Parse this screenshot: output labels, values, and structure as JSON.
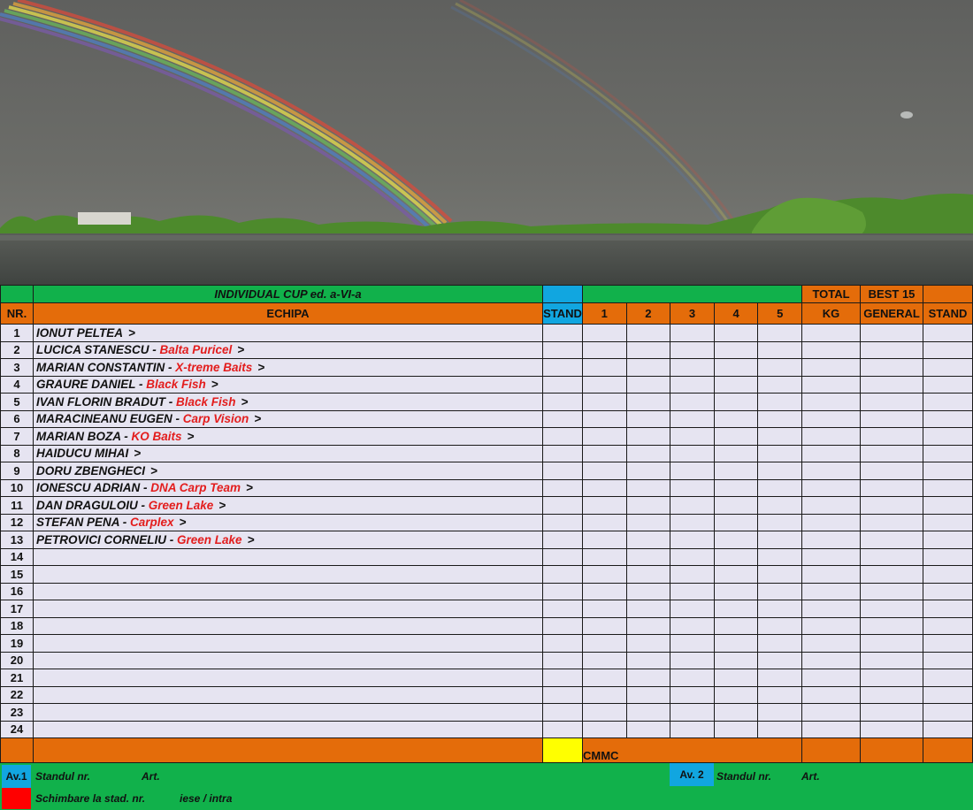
{
  "colors": {
    "green": "#11b14b",
    "orange": "#e46c0a",
    "blue": "#11a6e0",
    "team": "#e31d1d",
    "row_bg": "#e6e4f1",
    "yellow": "#ffff00"
  },
  "header": {
    "title": "INDIVIDUAL CUP ed. a-VI-a",
    "nr": "NR.",
    "echipa": "ECHIPA",
    "stand": "STAND",
    "sessions": [
      "1",
      "2",
      "3",
      "4",
      "5"
    ],
    "total": "TOTAL",
    "kg": "KG",
    "best": "BEST 15",
    "general": "GENERAL",
    "stand2": "STAND"
  },
  "rows": [
    {
      "nr": "1",
      "name": "IONUT PELTEA",
      "sep": "",
      "team": "",
      "tail": ">"
    },
    {
      "nr": "2",
      "name": "LUCICA STANESCU",
      "sep": " - ",
      "team": "Balta Puricel",
      "tail": ">"
    },
    {
      "nr": "3",
      "name": "MARIAN CONSTANTIN",
      "sep": " - ",
      "team": "X-treme Baits",
      "tail": ">"
    },
    {
      "nr": "4",
      "name": "GRAURE DANIEL",
      "sep": " - ",
      "team": "Black Fish",
      "tail": ">"
    },
    {
      "nr": "5",
      "name": "IVAN FLORIN BRADUT",
      "sep": " - ",
      "team": "Black Fish",
      "tail": ">"
    },
    {
      "nr": "6",
      "name": "MARACINEANU EUGEN",
      "sep": " - ",
      "team": "Carp Vision",
      "tail": ">"
    },
    {
      "nr": "7",
      "name": "MARIAN BOZA",
      "sep": " - ",
      "team": "KO Baits",
      "tail": ">"
    },
    {
      "nr": "8",
      "name": "HAIDUCU MIHAI",
      "sep": "",
      "team": "",
      "tail": ">"
    },
    {
      "nr": "9",
      "name": "DORU ZBENGHECI",
      "sep": "",
      "team": "",
      "tail": ">"
    },
    {
      "nr": "10",
      "name": "IONESCU ADRIAN",
      "sep": " - ",
      "team": "DNA Carp Team",
      "tail": ">"
    },
    {
      "nr": "11",
      "name": "DAN DRAGULOIU",
      "sep": " - ",
      "team": "Green Lake",
      "tail": ">"
    },
    {
      "nr": "12",
      "name": "STEFAN PENA",
      "sep": " - ",
      "team": "Carplex",
      "tail": ">"
    },
    {
      "nr": "13",
      "name": "PETROVICI CORNELIU",
      "sep": " - ",
      "team": "Green Lake",
      "tail": ">"
    },
    {
      "nr": "14",
      "name": "",
      "sep": "",
      "team": "",
      "tail": ""
    },
    {
      "nr": "15",
      "name": "",
      "sep": "",
      "team": "",
      "tail": ""
    },
    {
      "nr": "16",
      "name": "",
      "sep": "",
      "team": "",
      "tail": ""
    },
    {
      "nr": "17",
      "name": "",
      "sep": "",
      "team": "",
      "tail": ""
    },
    {
      "nr": "18",
      "name": "",
      "sep": "",
      "team": "",
      "tail": ""
    },
    {
      "nr": "19",
      "name": "",
      "sep": "",
      "team": "",
      "tail": ""
    },
    {
      "nr": "20",
      "name": "",
      "sep": "",
      "team": "",
      "tail": ""
    },
    {
      "nr": "21",
      "name": "",
      "sep": "",
      "team": "",
      "tail": ""
    },
    {
      "nr": "22",
      "name": "",
      "sep": "",
      "team": "",
      "tail": ""
    },
    {
      "nr": "23",
      "name": "",
      "sep": "",
      "team": "",
      "tail": ""
    },
    {
      "nr": "24",
      "name": "",
      "sep": "",
      "team": "",
      "tail": ""
    }
  ],
  "footer": {
    "cmmc": "CMMC"
  },
  "legend": {
    "av1": "Av.1",
    "standul1": "Standul nr.",
    "art1": "Art.",
    "av2": "Av. 2",
    "standul2": "Standul  nr.",
    "art2": "Art.",
    "schimbare": "Schimbare la stad.  nr.",
    "iese": "iese / intra"
  }
}
